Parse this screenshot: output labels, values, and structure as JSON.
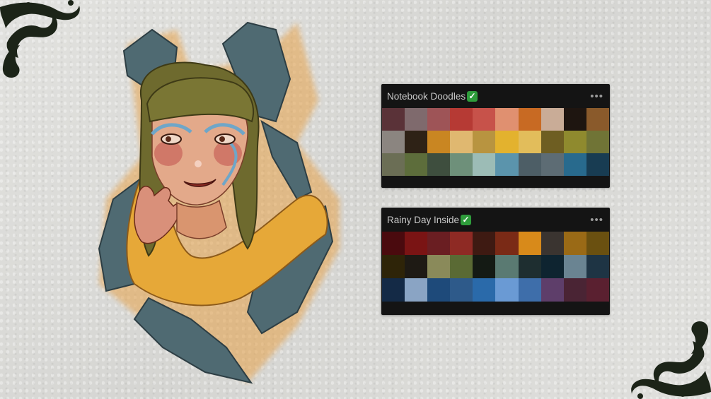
{
  "palettes": [
    {
      "title": "Notebook Doodles",
      "check_icon": "green-check-emoji",
      "menu_icon": "more-dots-icon",
      "swatches": [
        "#5a3238",
        "#7f6a6d",
        "#9e5457",
        "#b63a34",
        "#c7524a",
        "#e09070",
        "#c86a23",
        "#c9ac97",
        "#1e1510",
        "#8a5a2b",
        "#8b8580",
        "#2e2216",
        "#c98622",
        "#e0b870",
        "#b89440",
        "#e3b22e",
        "#e2bd5b",
        "#6e5e22",
        "#8f8a2e",
        "#707436",
        "#6b6e55",
        "#5d6d3b",
        "#3e4e3e",
        "#6e907a",
        "#9cbcb6",
        "#5b94ac",
        "#4d5e66",
        "#5d6c74",
        "#286a8d",
        "#183c52"
      ]
    },
    {
      "title": "Rainy Day Inside",
      "check_icon": "green-check-emoji",
      "menu_icon": "more-dots-icon",
      "swatches": [
        "#4a0a0e",
        "#7a1414",
        "#6a1e22",
        "#8e2a24",
        "#3e1a12",
        "#7a2a16",
        "#d88a1a",
        "#3a3430",
        "#9a6a16",
        "#6a5010",
        "#2e2408",
        "#1e1a14",
        "#8a8a5a",
        "#5a6a34",
        "#141a14",
        "#5a7a72",
        "#1e2e30",
        "#0e2430",
        "#6a8492",
        "#1e3444",
        "#142a46",
        "#8aa4c4",
        "#1e4a7a",
        "#2e5a8a",
        "#2a6aaa",
        "#6a9ad4",
        "#3e6eaa",
        "#5e3e6a",
        "#4a2434",
        "#5a2030"
      ]
    }
  ]
}
